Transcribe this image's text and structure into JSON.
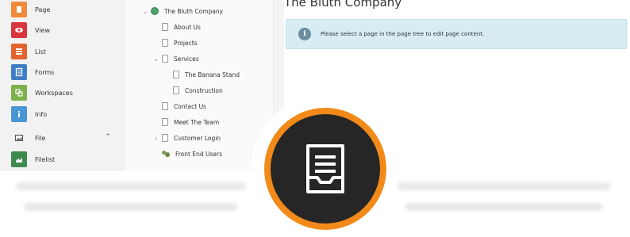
{
  "module_menu": {
    "items": [
      {
        "label": "Page",
        "icon": "page-icon",
        "color": "#f08a3a"
      },
      {
        "label": "View",
        "icon": "eye-icon",
        "color": "#d9363e"
      },
      {
        "label": "List",
        "icon": "list-icon",
        "color": "#e4632f"
      },
      {
        "label": "Forms",
        "icon": "form-icon",
        "color": "#3f7ec4"
      },
      {
        "label": "Workspaces",
        "icon": "workspaces-icon",
        "color": "#7bb04a"
      },
      {
        "label": "Info",
        "icon": "info-icon",
        "color": "#4a95d6"
      },
      {
        "label": "File",
        "icon": "image-icon",
        "color": "#555555"
      },
      {
        "label": "Filelist",
        "icon": "filelist-icon",
        "color": "#3d8a4f"
      }
    ]
  },
  "page_tree": {
    "items": [
      {
        "label": "The Bluth Company",
        "type": "root",
        "expander": "⌄"
      },
      {
        "label": "About Us",
        "type": "page"
      },
      {
        "label": "Projects",
        "type": "page"
      },
      {
        "label": "Services",
        "type": "page",
        "expander": "⌄"
      },
      {
        "label": "The Banana Stand",
        "type": "page"
      },
      {
        "label": "Construction",
        "type": "page"
      },
      {
        "label": "Contact Us",
        "type": "page"
      },
      {
        "label": "Meet The Team",
        "type": "page"
      },
      {
        "label": "Customer Login",
        "type": "page",
        "expander": "›"
      },
      {
        "label": "Front End Users",
        "type": "folder"
      }
    ]
  },
  "content": {
    "title": "The Bluth Company",
    "info_message": "Please select a page in the page tree to edit page content.",
    "info_icon_glyph": "i"
  },
  "badge": {
    "icon": "page-content-icon",
    "ring_color": "#f28a1a",
    "fill_color": "#262626"
  }
}
